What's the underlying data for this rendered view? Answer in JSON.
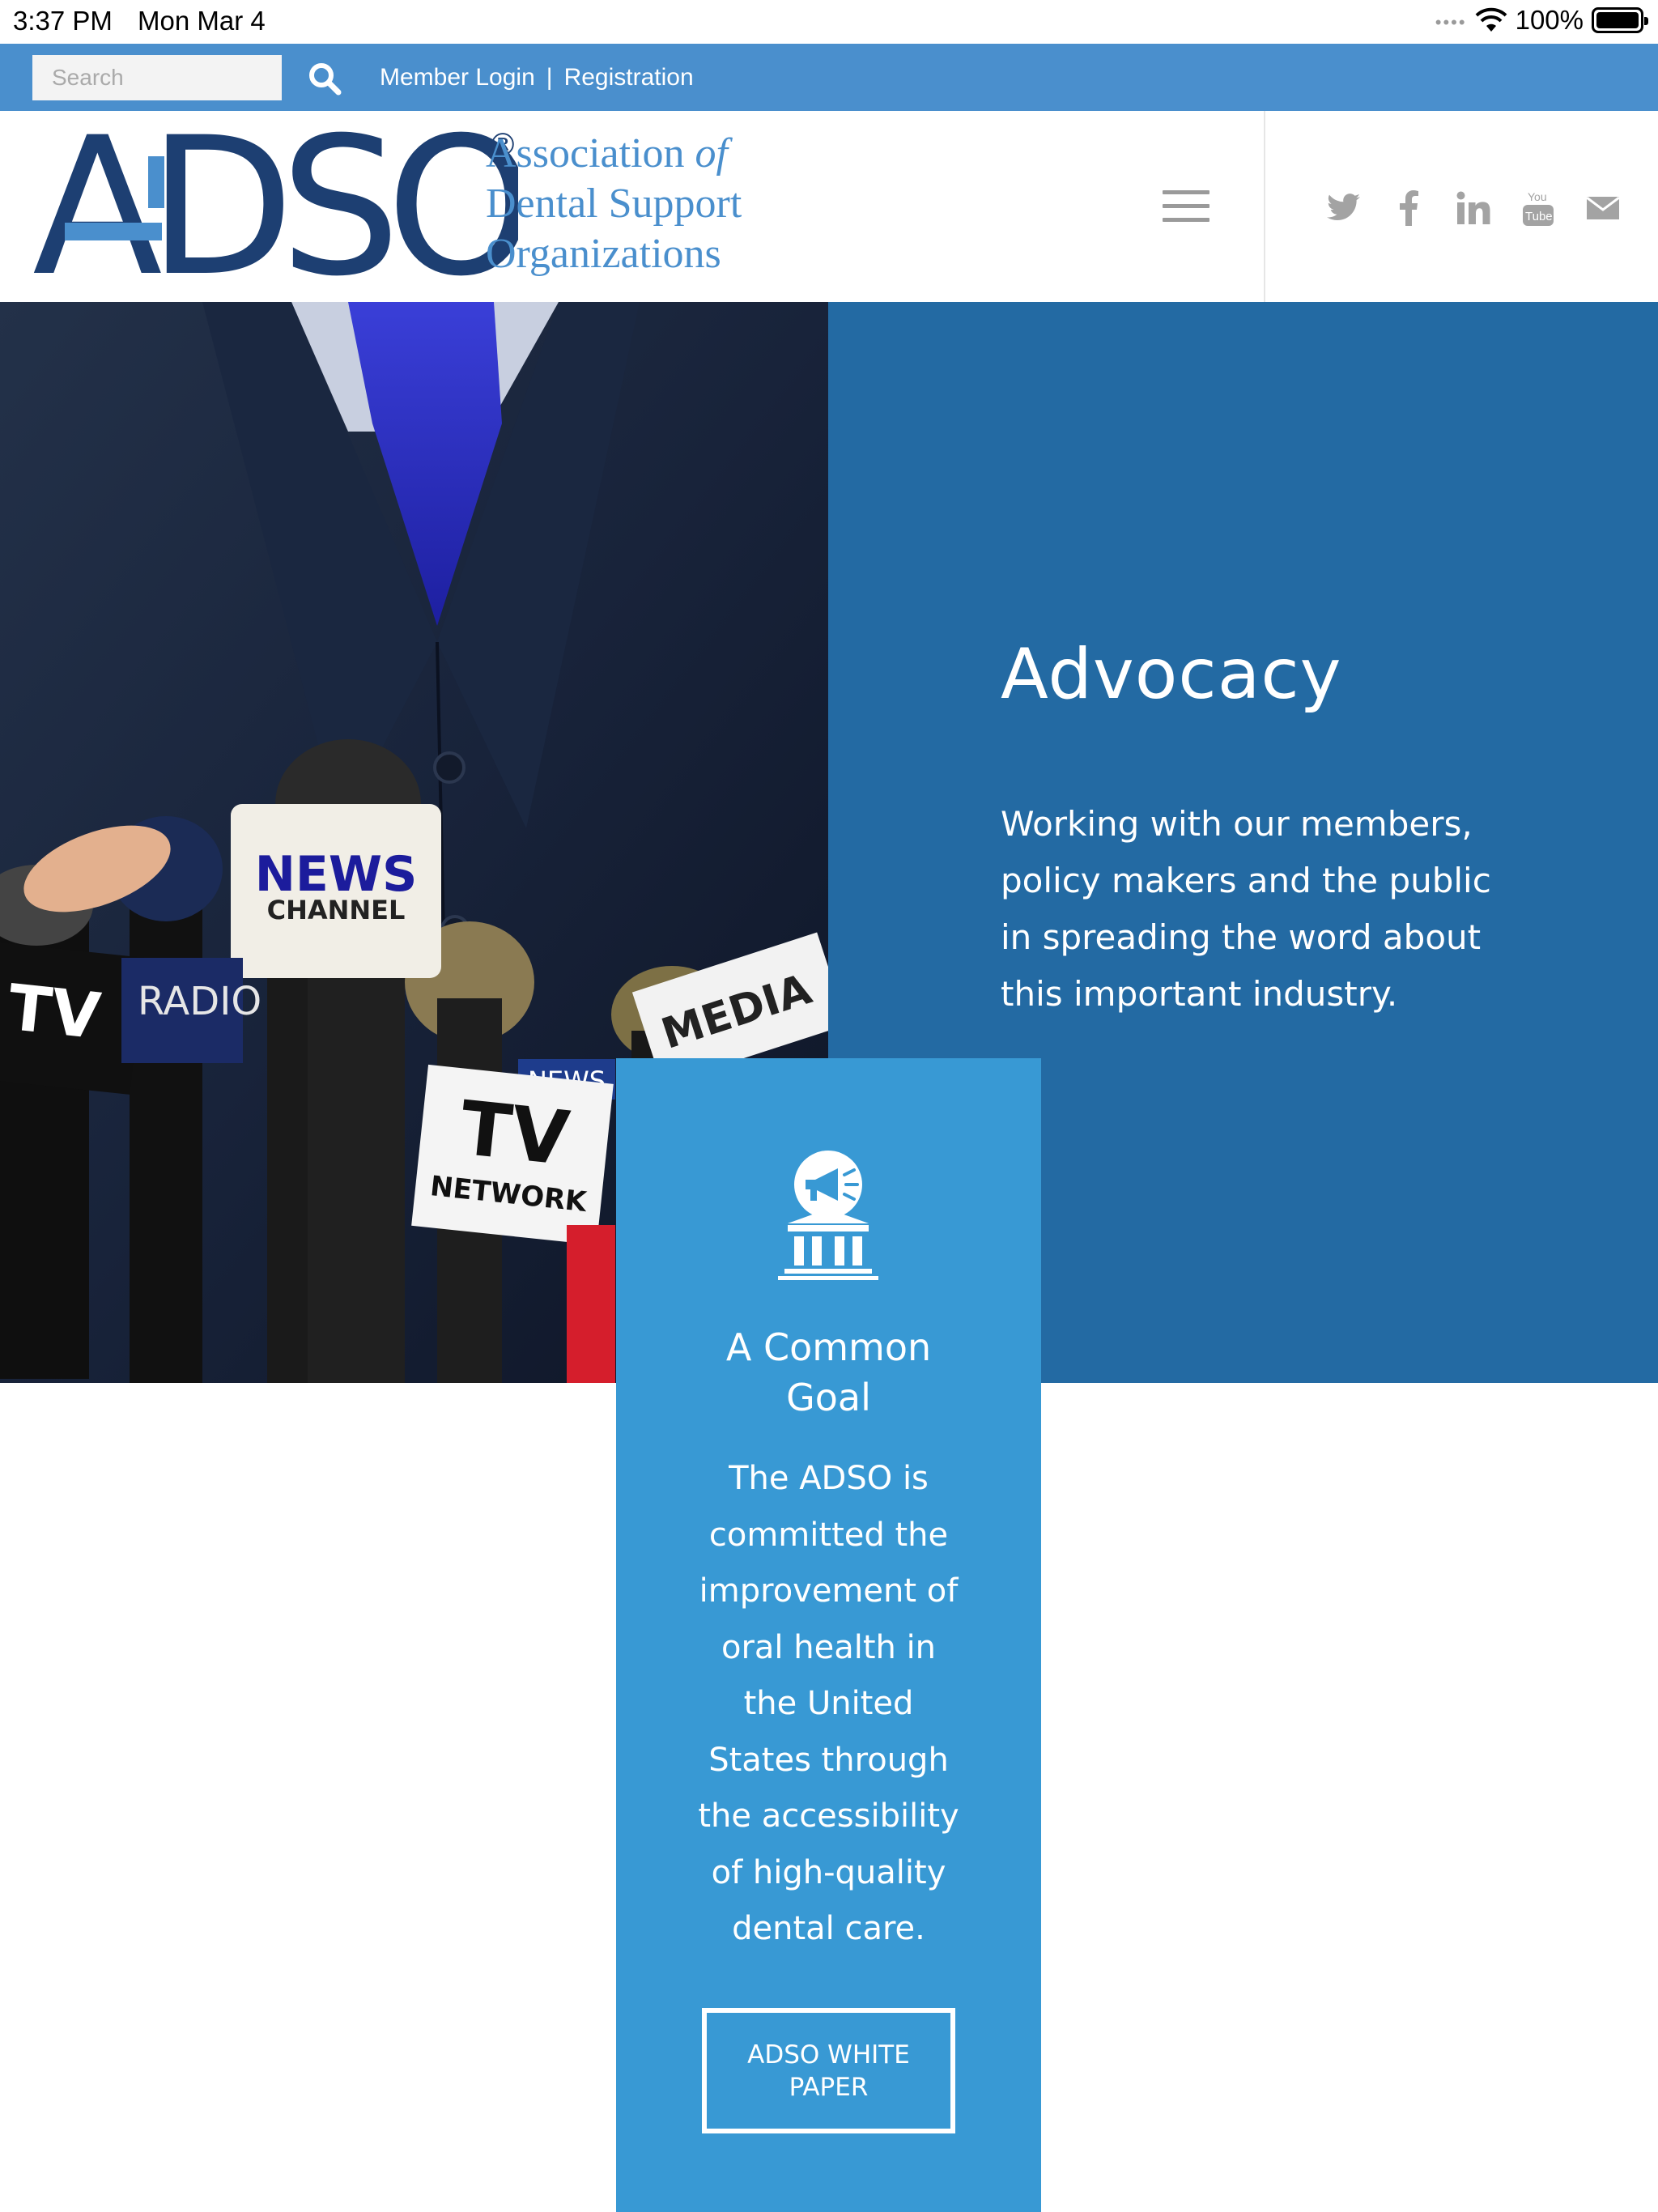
{
  "status_bar": {
    "time": "3:37 PM",
    "date": "Mon Mar 4",
    "battery": "100%"
  },
  "topbar": {
    "search_placeholder": "Search",
    "member_login": "Member Login",
    "separator": "|",
    "registration": "Registration",
    "bg_color": "#4a8fcd"
  },
  "header": {
    "logo_letters": "ADSO",
    "logo_registered": "®",
    "logo_line1": "Association",
    "logo_line1_italic": "of",
    "logo_line2": "Dental Support",
    "logo_line3": "Organizations",
    "social_icons": [
      "twitter-icon",
      "facebook-icon",
      "linkedin-icon",
      "youtube-icon",
      "mail-icon"
    ]
  },
  "hero": {
    "photo_labels": {
      "news": "NEWS",
      "channel": "CHANNEL",
      "tv": "TV",
      "radio": "RADIO",
      "tv_network_1": "TV",
      "tv_network_2": "NETWORK",
      "news_small": "NEWS",
      "media": "MEDIA"
    },
    "advocacy_title": "Advocacy",
    "advocacy_text": "Working with our members, policy makers and the public in spreading the word about this important industry.",
    "advocacy_color": "#236aa3"
  },
  "goal_card": {
    "icon": "megaphone-building-icon",
    "title": "A Common Goal",
    "text": "The ADSO is committed the improvement of oral health in the United States through the accessibility of high-quality dental care.",
    "button_label": "ADSO WHITE PAPER",
    "card_color": "#3899d4"
  }
}
